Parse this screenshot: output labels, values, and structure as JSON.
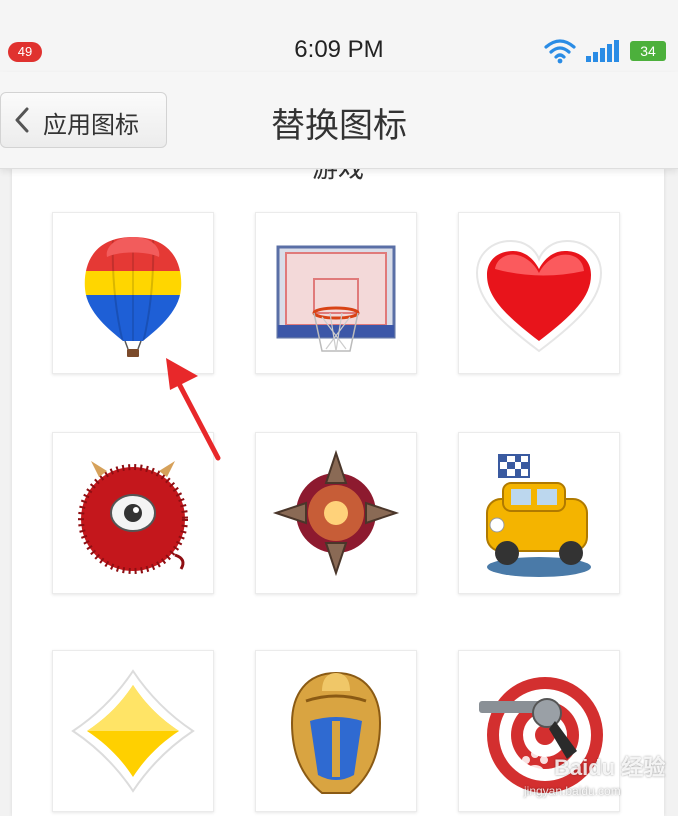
{
  "status_bar": {
    "notification_count": "49",
    "time": "6:09 PM",
    "battery": "34",
    "icons": [
      "wifi-icon",
      "signal-icon",
      "battery-icon"
    ]
  },
  "nav": {
    "back_label": "应用图标",
    "title": "替换图标"
  },
  "section": {
    "header": "游戏"
  },
  "icons": [
    "hot-air-balloon",
    "basketball-hoop",
    "red-heart",
    "red-monster",
    "compass-orb",
    "yellow-taxi",
    "yellow-diamond",
    "golden-helmet",
    "target-revolver"
  ],
  "watermark": {
    "main": "Baidu 经验",
    "sub": "jingyan.baidu.com"
  },
  "colors": {
    "accent_arrow": "#e8282a",
    "battery": "#4cb03c",
    "badge": "#e0322f",
    "wifi": "#2a8ce5"
  }
}
